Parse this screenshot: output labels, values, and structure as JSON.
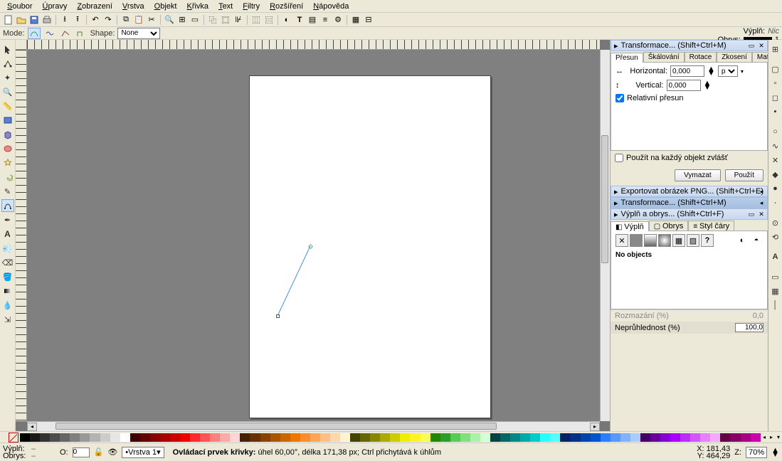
{
  "menu": {
    "items": [
      "Soubor",
      "Úpravy",
      "Zobrazení",
      "Vrstva",
      "Objekt",
      "Křivka",
      "Text",
      "Filtry",
      "Rozšíření",
      "Nápověda"
    ]
  },
  "toolctrl": {
    "mode_label": "Mode:",
    "shape_label": "Shape:",
    "shape_value": "None"
  },
  "indicator": {
    "fill_label": "Výplň:",
    "fill_value": "Nic",
    "stroke_label": "Obrys:",
    "stroke_num": "1"
  },
  "panels": {
    "transform": {
      "title": "Transformace... (Shift+Ctrl+M)",
      "tabs": [
        "Přesun",
        "Škálování",
        "Rotace",
        "Zkosení",
        "Matice"
      ],
      "horizontal_label": "Horizontal:",
      "vertical_label": "Vertical:",
      "horizontal_value": "0,000",
      "vertical_value": "0,000",
      "unit": "px",
      "relative_label": "Relativní přesun",
      "apply_each_label": "Použít na každý objekt zvlášť",
      "btn_clear": "Vymazat",
      "btn_apply": "Použít"
    },
    "export": {
      "title": "Exportovat obrázek PNG... (Shift+Ctrl+E)"
    },
    "transform2": {
      "title": "Transformace... (Shift+Ctrl+M)"
    },
    "fill": {
      "title": "Výplň a obrys... (Shift+Ctrl+F)",
      "tabs": [
        "Výplň",
        "Obrys",
        "Styl čáry"
      ],
      "no_objects": "No objects",
      "blur_label": "Rozmazání (%)",
      "blur_value": "0,0",
      "opacity_label": "Neprůhlednost (%)",
      "opacity_value": "100,0"
    }
  },
  "palette": [
    "#000000",
    "#1a1a1a",
    "#333333",
    "#4d4d4d",
    "#666666",
    "#808080",
    "#999999",
    "#b3b3b3",
    "#cccccc",
    "#e6e6e6",
    "#ffffff",
    "#440000",
    "#660000",
    "#880000",
    "#aa0000",
    "#cc0000",
    "#ee0000",
    "#ff2a2a",
    "#ff5555",
    "#ff8080",
    "#ffaaaa",
    "#ffd5d5",
    "#442200",
    "#663300",
    "#884400",
    "#aa5500",
    "#cc6600",
    "#ee7700",
    "#ff8c2a",
    "#ffa555",
    "#ffbf80",
    "#ffd8aa",
    "#fff2d5",
    "#444400",
    "#666600",
    "#888800",
    "#aaaa00",
    "#cccc00",
    "#eeee00",
    "#fff22a",
    "#f7ff55",
    "#228800",
    "#2aa02a",
    "#55cc55",
    "#80e080",
    "#aaf2aa",
    "#d5ffd5",
    "#004444",
    "#006666",
    "#008888",
    "#00aaaa",
    "#00cccc",
    "#2affff",
    "#55ffff",
    "#002266",
    "#003388",
    "#0044aa",
    "#0055cc",
    "#2a7fff",
    "#5599ff",
    "#80b3ff",
    "#aaccff",
    "#440066",
    "#660099",
    "#8800cc",
    "#aa00ff",
    "#bf2aff",
    "#d455ff",
    "#e680ff",
    "#f2aaff",
    "#660044",
    "#880066",
    "#aa0088",
    "#cc00aa"
  ],
  "status": {
    "fill_label": "Výplň:",
    "stroke_label": "Obrys:",
    "fill_value": "–",
    "stroke_value": "–",
    "opacity_label": "O:",
    "opacity_value": "0",
    "layer": "Vrstva 1",
    "hint_prefix": "Ovládací prvek křivky:",
    "hint_detail": " úhel 60,00°, délka 171,38 px; Ctrl přichytává k úhlům",
    "x_label": "X:",
    "y_label": "Y:",
    "x_value": "181,43",
    "y_value": "464,29",
    "z_label": "Z:",
    "zoom_value": "70%"
  }
}
